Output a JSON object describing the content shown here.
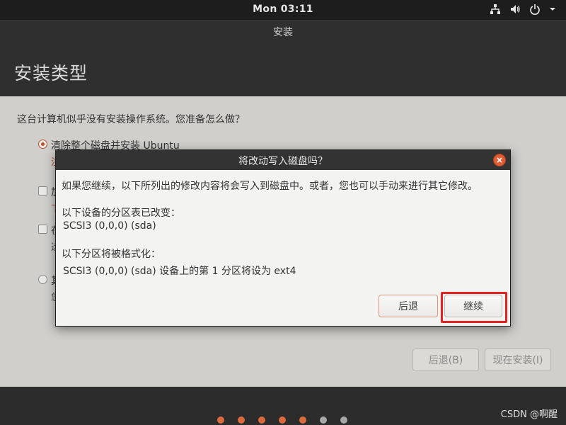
{
  "topbar": {
    "clock": "Mon 03:11",
    "icons": [
      "network-icon",
      "volume-icon",
      "power-icon",
      "menu-arrow-icon"
    ]
  },
  "window": {
    "title": "安装"
  },
  "header": {
    "title": "安装类型"
  },
  "main": {
    "question": "这台计算机似乎没有安装操作系统。您准备怎么做？",
    "options": [
      {
        "label": "清除整个磁盘并安装 Ubuntu",
        "sub": "注",
        "selected": true
      },
      {
        "label": "加",
        "sub": "下"
      },
      {
        "label": "在",
        "sub": "这"
      },
      {
        "label": "其",
        "sub": "您"
      }
    ],
    "back_label": "后退(B)",
    "install_label": "现在安装(I)"
  },
  "dialog": {
    "title": "将改动写入磁盘吗？",
    "intro": "如果您继续，以下所列出的修改内容将会写入到磁盘中。或者，您也可以手动来进行其它修改。",
    "partition_table_heading": "以下设备的分区表已改变：",
    "partition_table_device": "SCSI3 (0,0,0) (sda)",
    "format_heading": "以下分区将被格式化：",
    "format_item": "SCSI3 (0,0,0) (sda) 设备上的第 1 分区将设为 ext4",
    "back_label": "后退",
    "continue_label": "继续"
  },
  "footer": {
    "progress_dots": {
      "completed": 5,
      "total": 7
    },
    "watermark": "CSDN @啊醒"
  },
  "colors": {
    "accent": "#e05d34",
    "dot_done": "#dd6a3c",
    "dot_todo": "#a8a8a8",
    "highlight": "#e32222"
  }
}
